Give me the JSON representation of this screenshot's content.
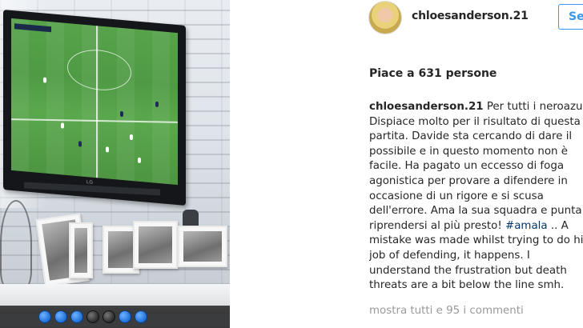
{
  "post": {
    "username": "chloesanderson.21",
    "follow_label": "Se",
    "likes_text": "Piace a 631 persone",
    "caption": {
      "user": "chloesanderson.21",
      "lines": [
        "Per tutti i neroazurr",
        "Dispiace molto per il risultato di questa",
        "partita. Davide sta cercando di dare il",
        "possibile e in questo momento non è",
        "facile. Ha pagato un eccesso di foga",
        "agonistica per provare a difendere in",
        "occasione di un rigore e si scusa",
        "dell'errore. Ama la sua squadra e punta a",
        "riprendersi al più presto!",
        "mistake was made whilst trying to do his",
        "job of defending, it happens. I",
        "understand the frustration but death",
        "threats are a bit below the line smh."
      ],
      "hashtag": "#amala",
      "after_hashtag": " .. A"
    },
    "view_comments": "mostra tutti e 95 i commenti"
  },
  "photo": {
    "tv_brand": "LG",
    "carousel": {
      "total": 7,
      "dark_indices": [
        3,
        4
      ]
    }
  },
  "colors": {
    "accent": "#3897f0",
    "hashtag": "#003569",
    "muted": "#999999",
    "text": "#262626"
  },
  "icons": {
    "carousel_dot": "carousel-dot-icon"
  }
}
